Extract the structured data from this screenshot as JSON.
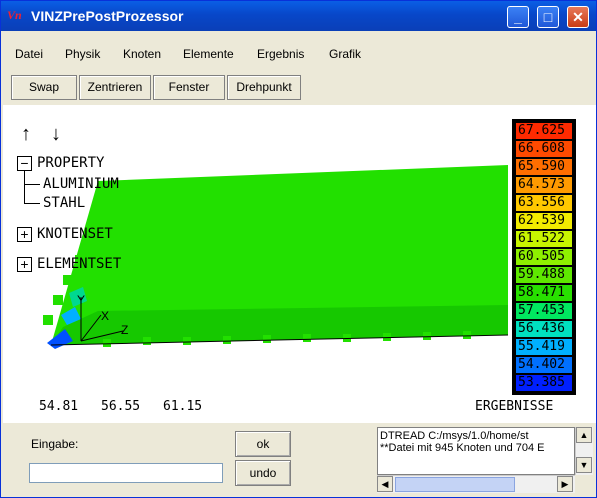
{
  "window": {
    "title": "VINZPrePostProzessor",
    "icon_text": "Vn"
  },
  "menu": [
    "Datei",
    "Physik",
    "Knoten",
    "Elemente",
    "Ergebnis",
    "Grafik"
  ],
  "toolbar": [
    "Swap",
    "Zentrieren",
    "Fenster",
    "Drehpunkt"
  ],
  "tree": {
    "property": "PROPERTY",
    "children": [
      "ALUMINIUM",
      "STAHL"
    ],
    "knotenset": "KNOTENSET",
    "elementset": "ELEMENTSET",
    "expand_symbol": "+",
    "collapse_symbol": "−"
  },
  "axes": {
    "x": "X",
    "y": "Y",
    "z": "Z"
  },
  "readouts": [
    "54.81",
    "56.55",
    "61.15"
  ],
  "legend": {
    "title": "ERGEBNISSE",
    "values": [
      "67.625",
      "66.608",
      "65.590",
      "64.573",
      "63.556",
      "62.539",
      "61.522",
      "60.505",
      "59.488",
      "58.471",
      "57.453",
      "56.436",
      "55.419",
      "54.402",
      "53.385"
    ],
    "colors": [
      "#ff2a00",
      "#ff4a00",
      "#ff6e00",
      "#ff9a00",
      "#ffc800",
      "#f2ec00",
      "#c8f500",
      "#8ef000",
      "#5ee800",
      "#28e000",
      "#00e860",
      "#00e0c0",
      "#00b0ff",
      "#0070ff",
      "#0020ff"
    ]
  },
  "bottom": {
    "eingabe_label": "Eingabe:",
    "input_value": "",
    "ok": "ok",
    "undo": "undo",
    "log": [
      "DTREAD C:/msys/1.0/home/st",
      "**Datei mit 945 Knoten und 704 E"
    ]
  }
}
